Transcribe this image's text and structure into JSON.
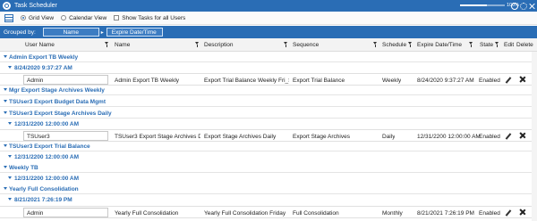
{
  "window": {
    "title": "Task Scheduler",
    "zoom": "100%"
  },
  "toolbar": {
    "grid_view": "Grid View",
    "calendar_view": "Calendar View",
    "show_all": "Show Tasks for all Users"
  },
  "grouping": {
    "label": "Grouped by:",
    "chips": [
      "Name",
      "Expire Date/Time"
    ]
  },
  "columns": [
    "User Name",
    "Name",
    "Description",
    "Sequence",
    "Schedule",
    "Expire Date/Time",
    "State",
    "Edit",
    "Delete"
  ],
  "groups": [
    {
      "name": "Admin Export TB Weekly",
      "date": "8/24/2020 9:37:27 AM",
      "row": {
        "user": "Admin",
        "name": "Admin Export TB Weekly",
        "description": "Export Trial Balance Weekly Fri_Sun",
        "sequence": "Export Trial Balance",
        "schedule": "Weekly",
        "expire": "8/24/2020 9:37:27 AM",
        "state": "Enabled"
      }
    },
    {
      "name": "Mgr Export Stage Archives Weekly"
    },
    {
      "name": "TSUser3 Export Budget Data Mgmt"
    },
    {
      "name": "TSUser3 Export Stage Archives Daily",
      "date": "12/31/2200 12:00:00 AM",
      "row": {
        "user": "TSUser3",
        "name": "TSUser3 Export Stage Archives D...",
        "description": "Export Stage Archives Daily",
        "sequence": "Export Stage Archives",
        "schedule": "Daily",
        "expire": "12/31/2200 12:00:00 AM",
        "state": "Enabled"
      }
    },
    {
      "name": "TSUser3 Export Trial Balance",
      "date": "12/31/2200 12:00:00 AM"
    },
    {
      "name": "Weekly TB",
      "date": "12/31/2200 12:00:00 AM"
    },
    {
      "name": "Yearly Full Consolidation",
      "date": "8/21/2021 7:26:19 PM",
      "row": {
        "user": "Admin",
        "name": "Yearly Full Consolidation",
        "description": "Yearly Full Consolidation Friday",
        "sequence": "Full Consolidation",
        "schedule": "Monthly",
        "expire": "8/21/2021 7:26:19 PM",
        "state": "Enabled"
      }
    }
  ]
}
